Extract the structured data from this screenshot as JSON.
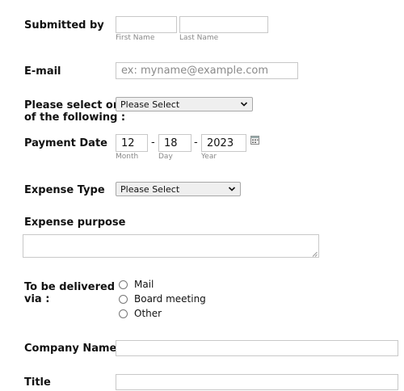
{
  "submitted_by": {
    "label": "Submitted by",
    "first_name_caption": "First Name",
    "last_name_caption": "Last Name"
  },
  "email": {
    "label": "E-mail",
    "placeholder": "ex: myname@example.com"
  },
  "select_one": {
    "label_line1": "Please select one",
    "label_line2": "of the following :",
    "value": "Please Select"
  },
  "payment_date": {
    "label": "Payment Date",
    "month": "12",
    "day": "18",
    "year": "2023",
    "separator": "-",
    "month_caption": "Month",
    "day_caption": "Day",
    "year_caption": "Year",
    "calendar_icon": "calendar-icon"
  },
  "expense_type": {
    "label": "Expense Type",
    "value": "Please Select"
  },
  "expense_purpose": {
    "label": "Expense purpose"
  },
  "delivery": {
    "label_line1": "To be delivered",
    "label_line2": "via :",
    "options": [
      "Mail",
      "Board meeting",
      "Other"
    ]
  },
  "company_name": {
    "label": "Company Name"
  },
  "title_field": {
    "label": "Title"
  }
}
